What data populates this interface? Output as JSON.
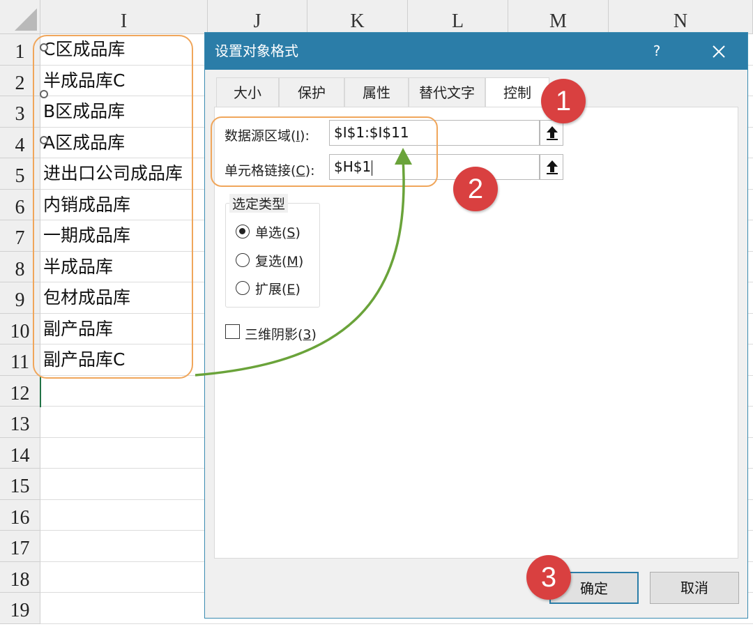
{
  "sheet": {
    "columns": [
      "I",
      "J",
      "K",
      "L",
      "M",
      "N"
    ],
    "rows": [
      "1",
      "2",
      "3",
      "4",
      "5",
      "6",
      "7",
      "8",
      "9",
      "10",
      "11",
      "12",
      "13",
      "14",
      "15",
      "16",
      "17",
      "18",
      "19"
    ],
    "cells": [
      "C区成品库",
      "半成品库C",
      "B区成品库",
      "A区成品库",
      "进出口公司成品库",
      "内销成品库",
      "一期成品库",
      "半成品库",
      "包材成品库",
      "副产品库",
      "副产品库C"
    ]
  },
  "dialog": {
    "title": "设置对象格式",
    "help": "?",
    "tabs": [
      "大小",
      "保护",
      "属性",
      "替代文字",
      "控制"
    ],
    "active_tab": "控制",
    "input_range": {
      "label_prefix": "数据源区域(",
      "label_key": "I",
      "label_suffix": "):",
      "value": "$I$1:$I$11"
    },
    "cell_link": {
      "label_prefix": "单元格链接(",
      "label_key": "C",
      "label_suffix": "):",
      "value": "$H$1"
    },
    "selection_type": {
      "title": "选定类型",
      "options": [
        {
          "prefix": "单选(",
          "key": "S",
          "suffix": ")",
          "checked": true
        },
        {
          "prefix": "复选(",
          "key": "M",
          "suffix": ")",
          "checked": false
        },
        {
          "prefix": "扩展(",
          "key": "E",
          "suffix": ")",
          "checked": false
        }
      ]
    },
    "shading": {
      "label_prefix": "三维阴影(",
      "key": "3",
      "label_suffix": ")",
      "checked": false
    },
    "ok": "确定",
    "cancel": "取消"
  },
  "annotations": {
    "steps": [
      "1",
      "2",
      "3"
    ]
  },
  "colors": {
    "titlebar": "#2b7da8",
    "highlight": "#f0a65b",
    "badge": "#d94040",
    "arrow": "#6aa33a"
  }
}
